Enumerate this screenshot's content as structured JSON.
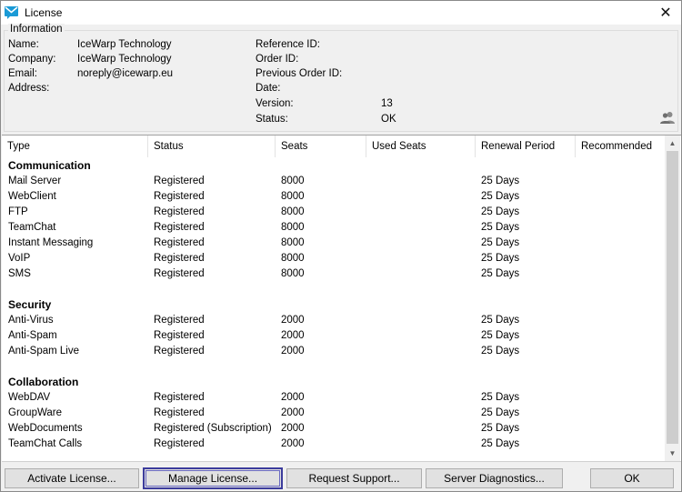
{
  "window": {
    "title": "License",
    "close_symbol": "✕"
  },
  "info": {
    "legend": "Information",
    "left": [
      {
        "label": "Name:",
        "value": "IceWarp Technology"
      },
      {
        "label": "Company:",
        "value": "IceWarp Technology"
      },
      {
        "label": "Email:",
        "value": "noreply@icewarp.eu"
      },
      {
        "label": "Address:",
        "value": ""
      }
    ],
    "right": [
      {
        "label": "Reference ID:",
        "value": ""
      },
      {
        "label": "Order ID:",
        "value": ""
      },
      {
        "label": "Previous Order ID:",
        "value": ""
      },
      {
        "label": "Date:",
        "value": ""
      },
      {
        "label": "Version:",
        "value": "13"
      },
      {
        "label": "Status:",
        "value": "OK"
      }
    ]
  },
  "table": {
    "headers": [
      "Type",
      "Status",
      "Seats",
      "Used Seats",
      "Renewal Period",
      "Recommended"
    ],
    "groups": [
      {
        "title": "Communication",
        "rows": [
          [
            "Mail Server",
            "Registered",
            "8000",
            "",
            "25 Days",
            ""
          ],
          [
            "WebClient",
            "Registered",
            "8000",
            "",
            "25 Days",
            ""
          ],
          [
            "FTP",
            "Registered",
            "8000",
            "",
            "25 Days",
            ""
          ],
          [
            "TeamChat",
            "Registered",
            "8000",
            "",
            "25 Days",
            ""
          ],
          [
            "Instant Messaging",
            "Registered",
            "8000",
            "",
            "25 Days",
            ""
          ],
          [
            "VoIP",
            "Registered",
            "8000",
            "",
            "25 Days",
            ""
          ],
          [
            "SMS",
            "Registered",
            "8000",
            "",
            "25 Days",
            ""
          ]
        ]
      },
      {
        "title": "Security",
        "rows": [
          [
            "Anti-Virus",
            "Registered",
            "2000",
            "",
            "25 Days",
            ""
          ],
          [
            "Anti-Spam",
            "Registered",
            "2000",
            "",
            "25 Days",
            ""
          ],
          [
            "Anti-Spam Live",
            "Registered",
            "2000",
            "",
            "25 Days",
            ""
          ]
        ]
      },
      {
        "title": "Collaboration",
        "rows": [
          [
            "WebDAV",
            "Registered",
            "2000",
            "",
            "25 Days",
            ""
          ],
          [
            "GroupWare",
            "Registered",
            "2000",
            "",
            "25 Days",
            ""
          ],
          [
            "WebDocuments",
            "Registered (Subscription)",
            "2000",
            "",
            "25 Days",
            ""
          ],
          [
            "TeamChat Calls",
            "Registered",
            "2000",
            "",
            "25 Days",
            ""
          ]
        ]
      }
    ]
  },
  "scrollbar": {
    "up_symbol": "▲",
    "down_symbol": "▼"
  },
  "buttons": {
    "activate": "Activate License...",
    "manage": "Manage License...",
    "support": "Request Support...",
    "diagnostics": "Server Diagnostics...",
    "ok": "OK"
  },
  "icons": {
    "app": "icewarp-logo-icon",
    "users": "users-icon"
  },
  "colors": {
    "accent": "#3c3c9c",
    "logo": "#1a9ad6"
  }
}
